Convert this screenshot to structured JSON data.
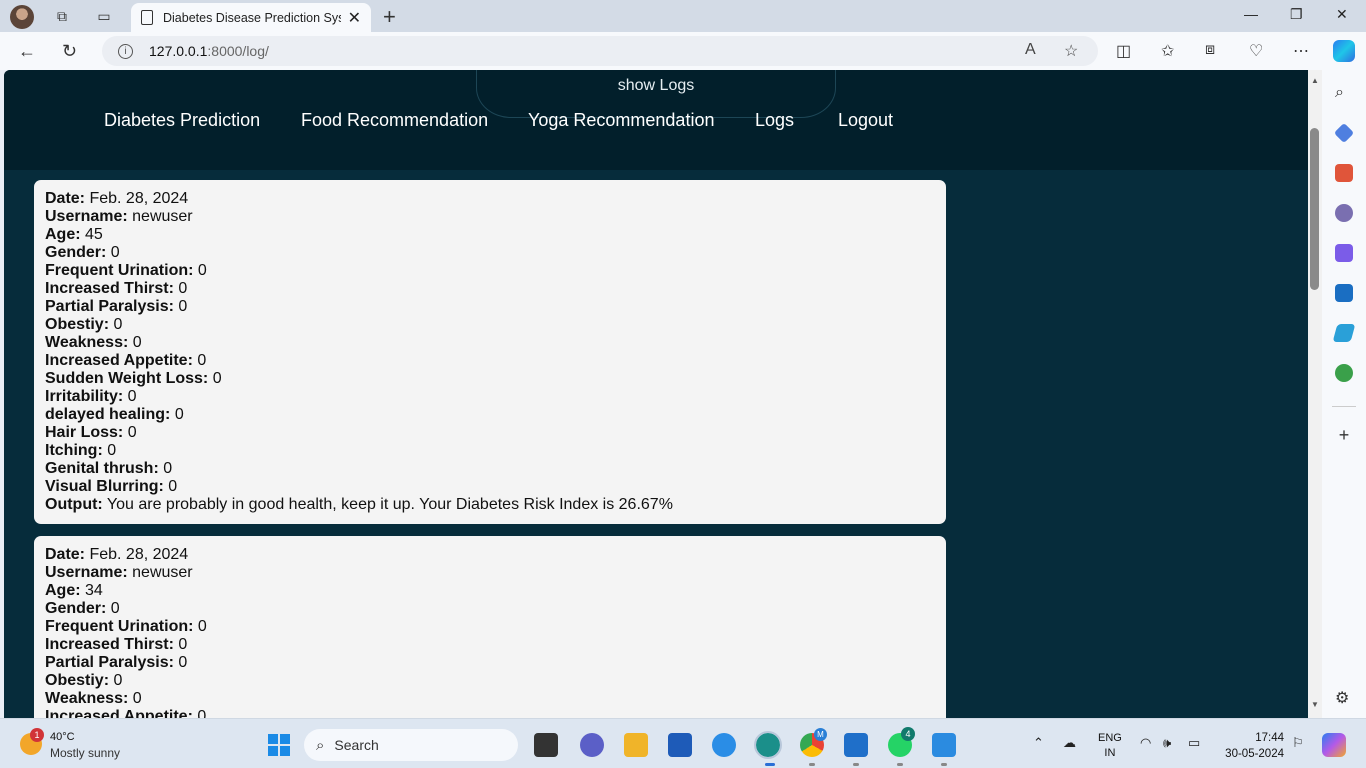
{
  "browser": {
    "tab_title": "Diabetes Disease Prediction Syste",
    "url_host": "127.0.0.1",
    "url_path": ":8000/log/"
  },
  "header": {
    "show_logs": "show Logs",
    "nav": [
      "Diabetes Prediction",
      "Food Recommendation",
      "Yoga Recommendation",
      "Logs",
      "Logout"
    ]
  },
  "logs": [
    {
      "rows": [
        {
          "label": "Date:",
          "value": " Feb. 28, 2024"
        },
        {
          "label": "Username:",
          "value": " newuser"
        },
        {
          "label": "Age:",
          "value": " 45"
        },
        {
          "label": "Gender:",
          "value": " 0"
        },
        {
          "label": "Frequent Urination:",
          "value": " 0"
        },
        {
          "label": "Increased Thirst:",
          "value": " 0"
        },
        {
          "label": "Partial Paralysis:",
          "value": " 0"
        },
        {
          "label": "Obestiy:",
          "value": " 0"
        },
        {
          "label": "Weakness:",
          "value": " 0"
        },
        {
          "label": "Increased Appetite:",
          "value": " 0"
        },
        {
          "label": "Sudden Weight Loss:",
          "value": " 0"
        },
        {
          "label": "Irritability:",
          "value": " 0"
        },
        {
          "label": "delayed healing:",
          "value": " 0"
        },
        {
          "label": "Hair Loss:",
          "value": " 0"
        },
        {
          "label": "Itching:",
          "value": " 0"
        },
        {
          "label": "Genital thrush:",
          "value": " 0"
        },
        {
          "label": "Visual Blurring:",
          "value": " 0"
        },
        {
          "label": "Output:",
          "value": " You are probably in good health, keep it up. Your Diabetes Risk Index is 26.67%"
        }
      ]
    },
    {
      "rows": [
        {
          "label": "Date:",
          "value": " Feb. 28, 2024"
        },
        {
          "label": "Username:",
          "value": " newuser"
        },
        {
          "label": "Age:",
          "value": " 34"
        },
        {
          "label": "Gender:",
          "value": " 0"
        },
        {
          "label": "Frequent Urination:",
          "value": " 0"
        },
        {
          "label": "Increased Thirst:",
          "value": " 0"
        },
        {
          "label": "Partial Paralysis:",
          "value": " 0"
        },
        {
          "label": "Obestiy:",
          "value": " 0"
        },
        {
          "label": "Weakness:",
          "value": " 0"
        },
        {
          "label": "Increased Appetite:",
          "value": " 0"
        }
      ]
    }
  ],
  "taskbar": {
    "temp": "40°C",
    "weather": "Mostly sunny",
    "weather_badge": "1",
    "search_placeholder": "Search",
    "lang_1": "ENG",
    "lang_2": "IN",
    "time": "17:44",
    "date": "30-05-2024",
    "edge_badge": "M",
    "whatsapp_badge": "4"
  },
  "colors": {
    "header_bg": "#021f2b",
    "page_bg": "#062c3b",
    "card_bg": "#f4f4f4"
  }
}
